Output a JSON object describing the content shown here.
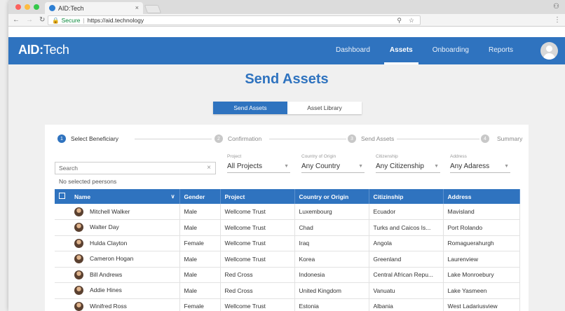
{
  "browser": {
    "tab_title": "AID:Tech",
    "tab_close": "×",
    "secure_label": "Secure",
    "url": "https://aid.technology",
    "zoom_icon": "search-icon",
    "star_icon": "star-icon"
  },
  "header": {
    "logo_bold": "AID:",
    "logo_rest": "Tech",
    "nav": [
      {
        "label": "Dashboard",
        "active": false
      },
      {
        "label": "Assets",
        "active": true
      },
      {
        "label": "Onboarding",
        "active": false
      },
      {
        "label": "Reports",
        "active": false
      }
    ],
    "accent": "#2f73bf"
  },
  "page": {
    "title": "Send Assets",
    "segments": [
      "Send Assets",
      "Asset Library"
    ],
    "steps": [
      {
        "num": "1",
        "label": "Select Beneficiary"
      },
      {
        "num": "2",
        "label": "Confirmation"
      },
      {
        "num": "3",
        "label": "Send Assets"
      },
      {
        "num": "4",
        "label": "Summary"
      }
    ],
    "search_placeholder": "Search",
    "filters": [
      {
        "label": "Project",
        "value": "All Projects"
      },
      {
        "label": "Country of Origin",
        "value": "Any Country"
      },
      {
        "label": "Citizenship",
        "value": "Any Citizenship"
      },
      {
        "label": "Address",
        "value": "Any Adaress"
      }
    ],
    "no_selection": "No selected peersons"
  },
  "table": {
    "columns": [
      "Name",
      "Gender",
      "Project",
      "Country or Origin",
      "Citizinship",
      "Address"
    ],
    "rows": [
      [
        "Mitchell Walker",
        "Male",
        "Wellcome Trust",
        "Luxembourg",
        "Ecuador",
        "Mavisland"
      ],
      [
        "Walter Day",
        "Male",
        "Wellcome Trust",
        "Chad",
        "Turks and Caicos Is...",
        "Port Rolando"
      ],
      [
        "Hulda Clayton",
        "Female",
        "Wellcome Trust",
        "Iraq",
        "Angola",
        "Romaguerahurgh"
      ],
      [
        "Cameron Hogan",
        "Male",
        "Wellcome Trust",
        "Korea",
        "Greenland",
        "Laurenview"
      ],
      [
        "Bill Andrews",
        "Male",
        "Red Cross",
        "Indonesia",
        "Central African Repu...",
        "Lake Monroebury"
      ],
      [
        "Addie Hines",
        "Male",
        "Red Cross",
        "United Kingdom",
        "Vanuatu",
        "Lake Yasmeen"
      ],
      [
        "Winifred Ross",
        "Female",
        "Wellcome Trust",
        "Estonia",
        "Albania",
        "West Ladariusview"
      ]
    ]
  }
}
